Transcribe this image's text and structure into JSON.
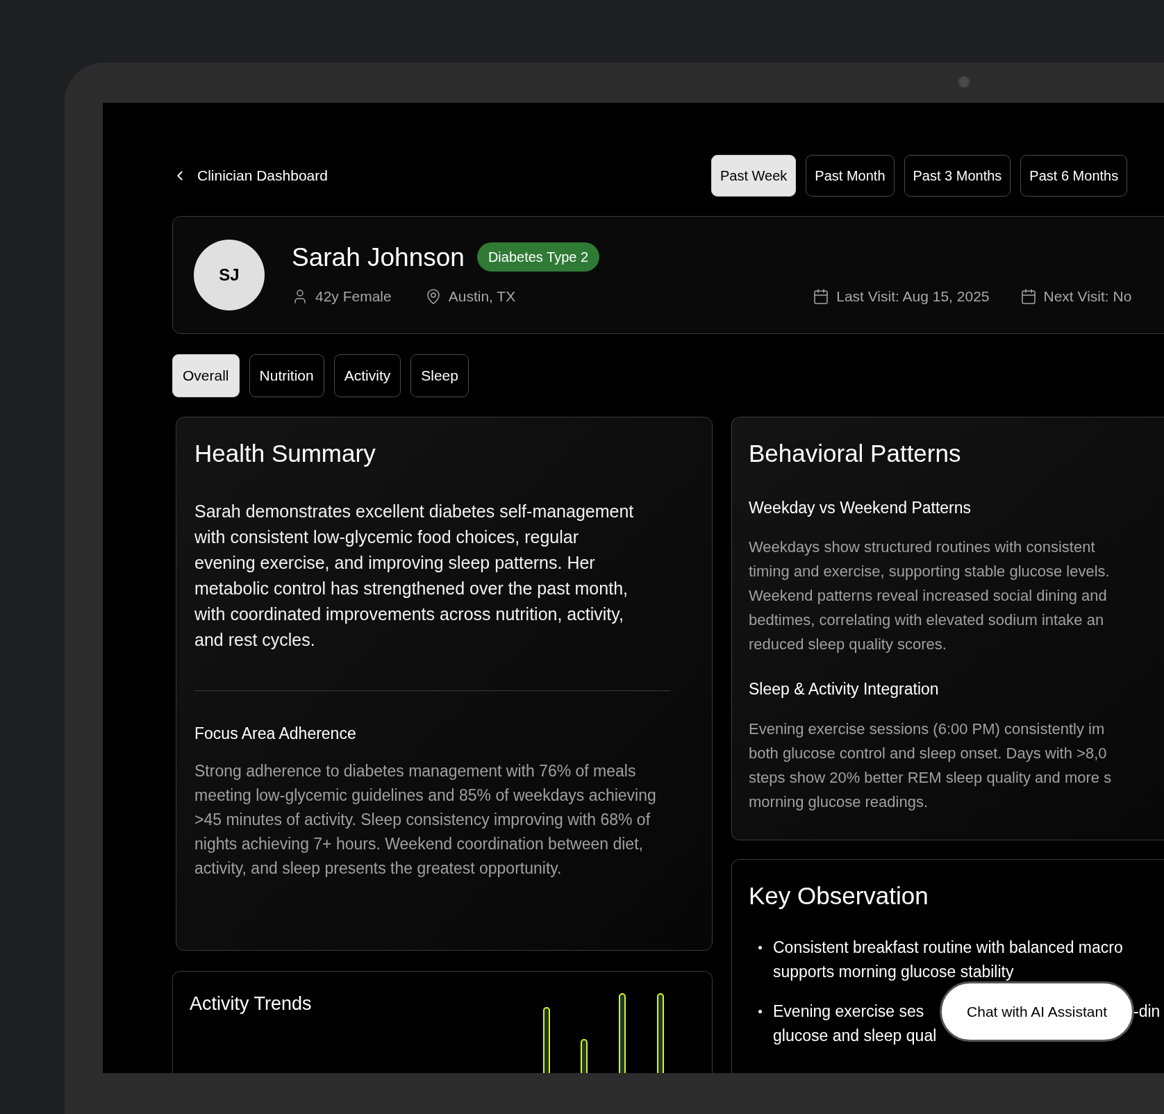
{
  "back_link": {
    "label": "Clinician Dashboard"
  },
  "ranges": [
    {
      "label": "Past Week",
      "selected": true
    },
    {
      "label": "Past Month",
      "selected": false
    },
    {
      "label": "Past 3 Months",
      "selected": false
    },
    {
      "label": "Past 6 Months",
      "selected": false
    }
  ],
  "patient": {
    "initials": "SJ",
    "name": "Sarah Johnson",
    "condition": "Diabetes Type 2",
    "details": [
      {
        "kind": "person",
        "text": "42y Female"
      },
      {
        "kind": "location",
        "text": "Austin, TX"
      }
    ],
    "visits": [
      {
        "kind": "calendar",
        "text": "Last Visit: Aug 15, 2025"
      },
      {
        "kind": "calendar",
        "text": "Next Visit: No"
      }
    ]
  },
  "tabs": [
    {
      "label": "Overall",
      "selected": true
    },
    {
      "label": "Nutrition",
      "selected": false
    },
    {
      "label": "Activity",
      "selected": false
    },
    {
      "label": "Sleep",
      "selected": false
    }
  ],
  "health_summary": {
    "title": "Health Summary",
    "summary": "Sarah demonstrates excellent diabetes self-management with consistent low-glycemic food choices, regular evening exercise, and improving sleep patterns. Her metabolic control has strengthened over the past month, with coordinated improvements across nutrition, activity, and rest cycles.",
    "subtitle": "Focus Area Adherence",
    "text": "Strong adherence to diabetes management with 76% of meals meeting low-glycemic guidelines and 85% of weekdays achieving >45 minutes of activity. Sleep consistency improving with 68% of nights achieving 7+ hours. Weekend coordination between diet, activity, and sleep presents the greatest opportunity."
  },
  "activity_trends": {
    "title": "Activity Trends"
  },
  "behavioral_patterns": {
    "title": "Behavioral Patterns",
    "sections": [
      {
        "heading": "Weekday vs Weekend Patterns",
        "lines": [
          "Weekdays show structured routines with consistent",
          "timing and exercise, supporting stable glucose levels.",
          "Weekend patterns reveal increased social dining and",
          "bedtimes, correlating with elevated sodium intake an",
          "reduced sleep quality scores."
        ]
      },
      {
        "heading": "Sleep & Activity Integration",
        "lines": [
          "Evening exercise sessions (6:00 PM) consistently im",
          "both glucose control and sleep onset. Days with >8,0",
          "steps show 20% better REM sleep quality and more s",
          "morning glucose readings."
        ]
      }
    ]
  },
  "key_observation": {
    "title": "Key Observation",
    "bullets": [
      {
        "lines": [
          "Consistent breakfast routine with balanced macro",
          "supports morning glucose stability"
        ]
      },
      {
        "lines": [
          "Evening exercise ses",
          "glucose and sleep qual"
        ],
        "tail": "-din"
      }
    ]
  },
  "chat_button": {
    "label": "Chat with AI Assistant"
  }
}
